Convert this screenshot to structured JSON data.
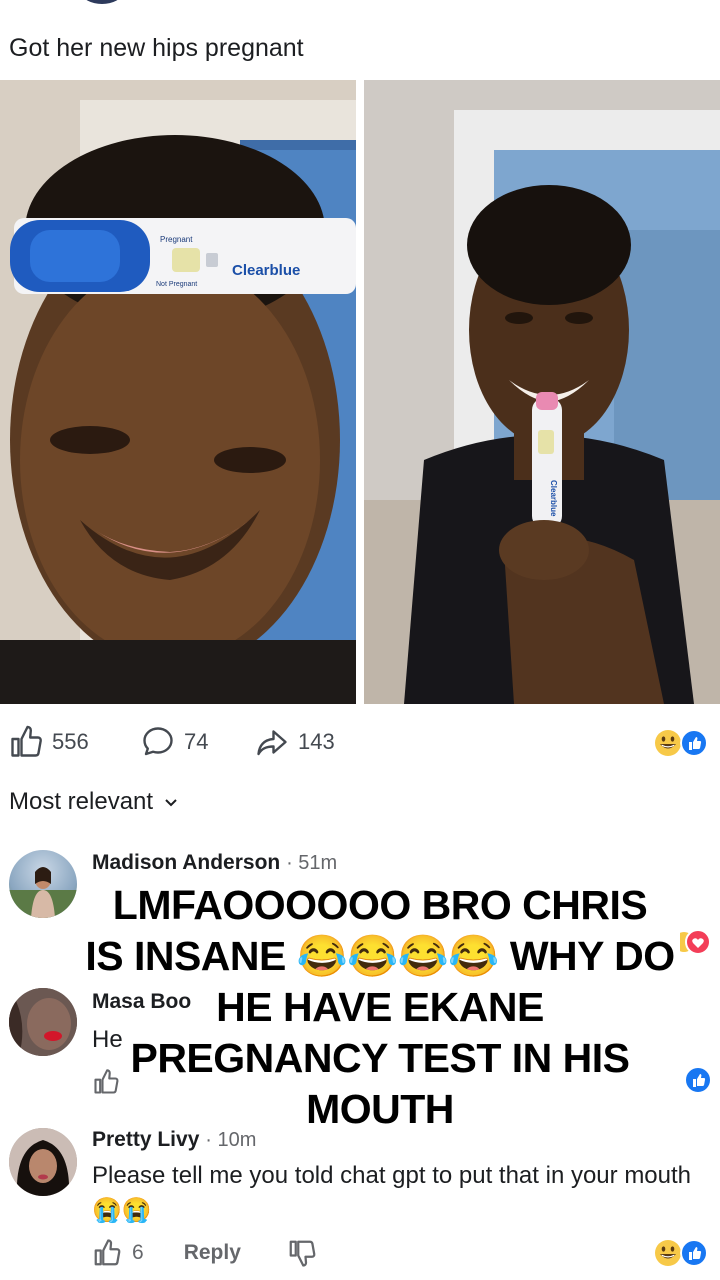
{
  "post": {
    "caption": "Got her new hips pregnant",
    "test_label_pregnant": "Pregnant",
    "test_label_not_pregnant": "Not Pregnant",
    "test_brand": "Clearblue",
    "test_brand_small": "Clearblue"
  },
  "stats": {
    "likes": "556",
    "comments": "74",
    "shares": "143",
    "reactions": [
      "grinning-face",
      "like"
    ]
  },
  "sort": {
    "label": "Most relevant"
  },
  "comments": [
    {
      "name": "Madison Anderson",
      "time": "· 51m",
      "reactions": [
        "love"
      ]
    },
    {
      "name": "Masa Boo",
      "partial_text": "He",
      "reactions": [
        "like"
      ]
    },
    {
      "name": "Pretty Livy",
      "time": "· 10m",
      "text": "Please tell me you told chat gpt to put that in your mouth",
      "emojis": "😭😭",
      "likes": "6",
      "reply": "Reply",
      "reactions": [
        "grinning-face",
        "like"
      ]
    }
  ],
  "overlay": {
    "line1": "LMFAOOOOOO BRO CHRIS",
    "line2": "IS INSANE 😂😂😂😂 WHY DO",
    "line3": "HE HAVE EKANE",
    "line4": "PREGNANCY TEST IN HIS",
    "line5": "MOUTH"
  },
  "colors": {
    "fb_blue": "#1877f2",
    "love_red": "#f33e58",
    "emoji_yellow": "#f7c948",
    "text": "#1c1e21",
    "muted": "#65676b"
  }
}
